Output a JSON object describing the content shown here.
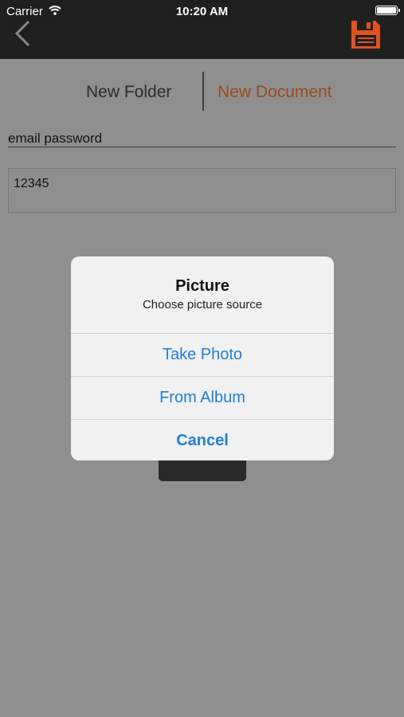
{
  "status_bar": {
    "carrier": "Carrier",
    "time": "10:20 AM"
  },
  "nav": {
    "back_icon": "chevron-left-icon",
    "save_icon": "floppy-disk-icon",
    "accent": "#e0521f"
  },
  "segment": {
    "left_label": "New Folder",
    "right_label": "New Document"
  },
  "form": {
    "title_value": "email password",
    "body_value": "12345"
  },
  "alert": {
    "title": "Picture",
    "message": "Choose picture source",
    "buttons": [
      "Take Photo",
      "From Album",
      "Cancel"
    ]
  },
  "colors": {
    "button_blue": "#1f7fd6",
    "active_segment": "#9a4a1d"
  }
}
